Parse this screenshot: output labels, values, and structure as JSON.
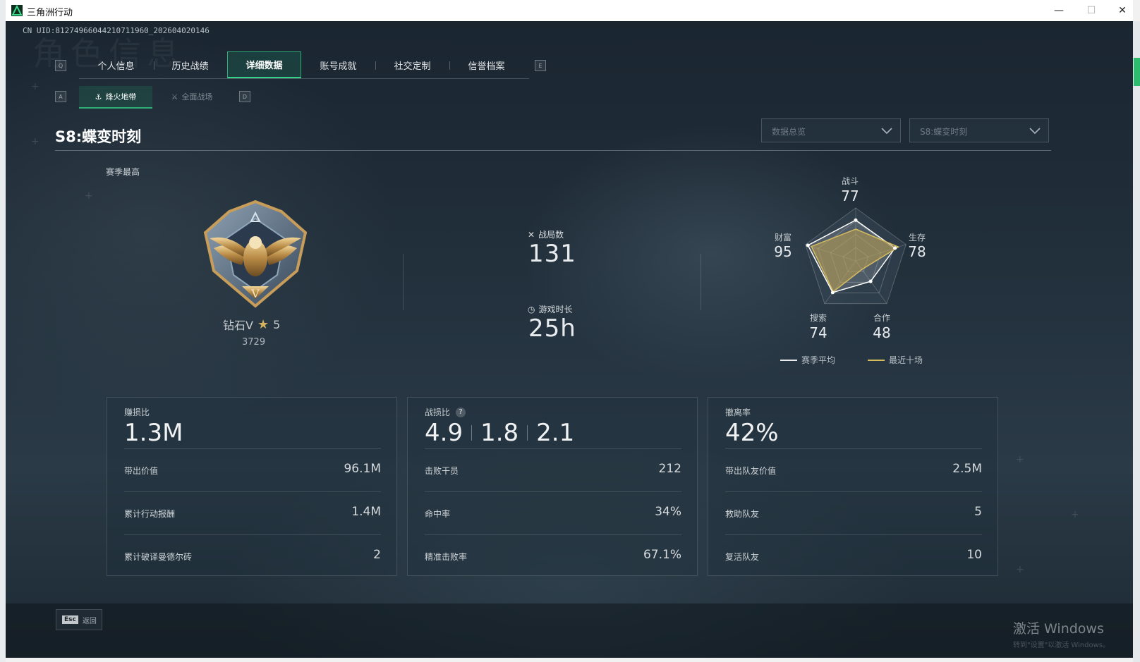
{
  "window": {
    "title": "三角洲行动",
    "minimize": "—",
    "maximize": "☐",
    "close": "✕"
  },
  "header": {
    "uid": "CN UID:8127496604421071196​0_202604020146",
    "bg_text": "角色信息"
  },
  "tabs": {
    "left_key": "Q",
    "right_key": "E",
    "items": [
      {
        "label": "个人信息"
      },
      {
        "label": "历史战绩"
      },
      {
        "label": "详细数据",
        "active": true
      },
      {
        "label": "账号成就"
      },
      {
        "label": "社交定制"
      },
      {
        "label": "信誉档案"
      }
    ]
  },
  "subtabs": {
    "left_key": "A",
    "right_key": "D",
    "items": [
      {
        "label": "烽火地带",
        "active": true
      },
      {
        "label": "全面战场",
        "active": false
      }
    ]
  },
  "season": {
    "title": "S8:蝶变时刻",
    "dropdown_view": "数据总览",
    "dropdown_season": "S8:蝶变时刻"
  },
  "rank": {
    "section_label": "赛季最高",
    "name": "钻石V",
    "stars": "5",
    "score": "3729"
  },
  "summary": {
    "matches_label": "战局数",
    "matches_value": "131",
    "playtime_label": "游戏时长",
    "playtime_value": "25h"
  },
  "radar": {
    "axes": [
      {
        "label": "战斗",
        "value": "77"
      },
      {
        "label": "生存",
        "value": "78"
      },
      {
        "label": "合作",
        "value": "48"
      },
      {
        "label": "搜索",
        "value": "74"
      },
      {
        "label": "财富",
        "value": "95"
      }
    ],
    "season_avg": [
      77,
      78,
      48,
      74,
      95
    ],
    "recent_ten": [
      60,
      85,
      20,
      72,
      88
    ],
    "legend_avg": "赛季平均",
    "legend_recent": "最近十场",
    "color_avg": "#ffffff",
    "color_recent": "#d6bb5f"
  },
  "panels": [
    {
      "title": "赚损比",
      "big": [
        "1.3M"
      ],
      "rows": [
        {
          "label": "带出价值",
          "value": "96.1M"
        },
        {
          "label": "累计行动报酬",
          "value": "1.4M"
        },
        {
          "label": "累计破译曼德尔砖",
          "value": "2"
        }
      ]
    },
    {
      "title": "战损比",
      "has_help": true,
      "help": "?",
      "big": [
        "4.9",
        "1.8",
        "2.1"
      ],
      "rows": [
        {
          "label": "击败干员",
          "value": "212"
        },
        {
          "label": "命中率",
          "value": "34%"
        },
        {
          "label": "精准击败率",
          "value": "67.1%"
        }
      ]
    },
    {
      "title": "撤离率",
      "big": [
        "42%"
      ],
      "rows": [
        {
          "label": "带出队友价值",
          "value": "2.5M"
        },
        {
          "label": "救助队友",
          "value": "5"
        },
        {
          "label": "复活队友",
          "value": "10"
        }
      ]
    }
  ],
  "footer": {
    "esc_key": "Esc",
    "back_label": "返回",
    "watermark": "激活 Windows",
    "watermark_sub": "转到\"设置\"以激活 Windows。"
  }
}
